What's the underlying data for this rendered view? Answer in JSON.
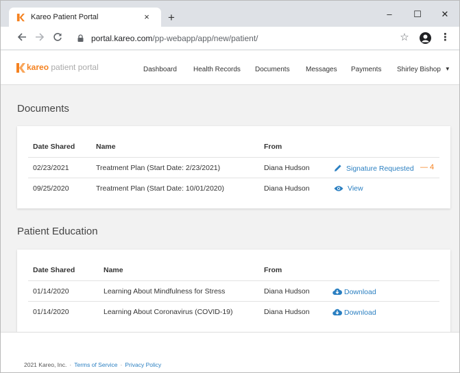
{
  "browser": {
    "tab_title": "Kareo Patient Portal",
    "tab_close": "×",
    "new_tab": "+",
    "window_controls": {
      "minimize": "–",
      "maximize": "☐",
      "close": "✕"
    },
    "url_host": "portal.kareo.com",
    "url_path": "/pp-webapp/app/new/patient/",
    "icons": [
      "kareo-favicon-icon",
      "back-arrow-icon",
      "forward-arrow-icon",
      "reload-icon",
      "lock-icon",
      "star-icon",
      "profile-icon",
      "kebab-menu-icon"
    ]
  },
  "app": {
    "logo_brand": "kareo",
    "logo_sub": " patient portal",
    "nav": [
      "Dashboard",
      "Health Records",
      "Documents",
      "Messages",
      "Payments"
    ],
    "user_name": "Shirley Bishop",
    "accent_color": "#f58220",
    "link_color": "#2a7fc1"
  },
  "documents": {
    "title": "Documents",
    "headers": {
      "date": "Date Shared",
      "name": "Name",
      "from": "From"
    },
    "rows": [
      {
        "date": "02/23/2021",
        "name": "Treatment Plan (Start Date: 2/23/2021)",
        "from": "Diana Hudson",
        "action": "Signature Requested",
        "action_icon": "pencil-icon",
        "count": "— 4"
      },
      {
        "date": "09/25/2020",
        "name": "Treatment Plan (Start Date: 10/01/2020)",
        "from": "Diana Hudson",
        "action": "View",
        "action_icon": "eye-icon"
      }
    ]
  },
  "education": {
    "title": "Patient Education",
    "headers": {
      "date": "Date Shared",
      "name": "Name",
      "from": "From"
    },
    "rows": [
      {
        "date": "01/14/2020",
        "name": "Learning About Mindfulness for Stress",
        "from": "Diana Hudson",
        "action": "Download",
        "action_icon": "cloud-download-icon"
      },
      {
        "date": "01/14/2020",
        "name": "Learning About Coronavirus (COVID-19)",
        "from": "Diana Hudson",
        "action": "Download",
        "action_icon": "cloud-download-icon"
      }
    ]
  },
  "footer": {
    "copyright": "2021 Kareo, Inc.",
    "separator": "·",
    "terms": "Terms of Service",
    "privacy": "Privacy Policy"
  }
}
